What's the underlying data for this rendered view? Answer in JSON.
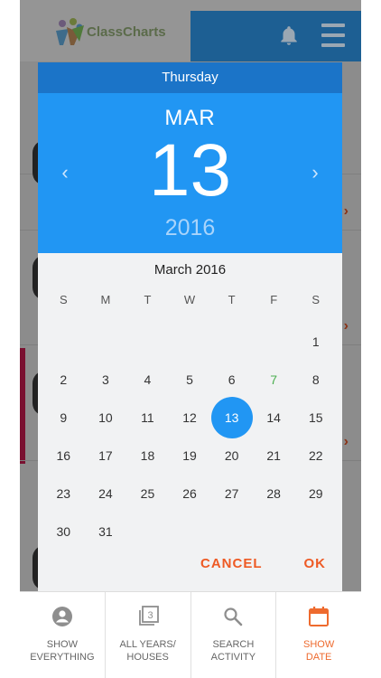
{
  "app": {
    "logo_text": "ClassCharts"
  },
  "dialog": {
    "weekday_header": "Thursday",
    "month_abbr": "MAR",
    "day": "13",
    "year": "2016",
    "calendar_title": "March 2016",
    "weekdays": [
      "S",
      "M",
      "T",
      "W",
      "T",
      "F",
      "S"
    ],
    "weeks": [
      [
        "",
        "",
        "",
        "",
        "",
        "",
        "1"
      ],
      [
        "2",
        "3",
        "4",
        "5",
        "6",
        "7",
        "8"
      ],
      [
        "9",
        "10",
        "11",
        "12",
        "13",
        "14",
        "15"
      ],
      [
        "16",
        "17",
        "18",
        "19",
        "20",
        "21",
        "22"
      ],
      [
        "23",
        "24",
        "25",
        "26",
        "27",
        "28",
        "29"
      ],
      [
        "30",
        "31",
        "",
        "",
        "",
        "",
        ""
      ]
    ],
    "today": "7",
    "selected": "13",
    "cancel_label": "CANCEL",
    "ok_label": "OK"
  },
  "bottom_tabs": [
    {
      "line1": "SHOW",
      "line2": "EVERYTHING",
      "icon": "account-circle-icon"
    },
    {
      "line1": "ALL YEARS/",
      "line2": "HOUSES",
      "icon": "stack-3-icon",
      "badge": "3"
    },
    {
      "line1": "SEARCH",
      "line2": "ACTIVITY",
      "icon": "search-icon"
    },
    {
      "line1": "SHOW",
      "line2": "DATE",
      "icon": "calendar-icon",
      "active": true
    }
  ],
  "colors": {
    "primary": "#2196f3",
    "primary_dark": "#1b74c8",
    "accent": "#ee5a24",
    "today": "#4caf50"
  }
}
